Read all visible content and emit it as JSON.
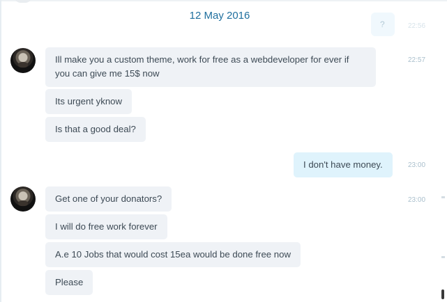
{
  "date_separator": "12 May 2016",
  "partial_above": {
    "bubble_text": "?",
    "time": "22:56"
  },
  "groups": [
    {
      "time": "22:57",
      "messages": [
        "Ill make you a custom theme, work for free as a webdeveloper for ever if you can give me 15$ now",
        "Its urgent yknow",
        "Is that a good deal?"
      ]
    },
    {
      "time": "23:00",
      "messages": [
        "I don't have money."
      ]
    },
    {
      "time": "23:00",
      "messages": [
        "Get one of your donators?",
        "I will do free work forever",
        "A.e 10 Jobs that would cost 15ea would be done free now",
        "Please"
      ]
    }
  ]
}
